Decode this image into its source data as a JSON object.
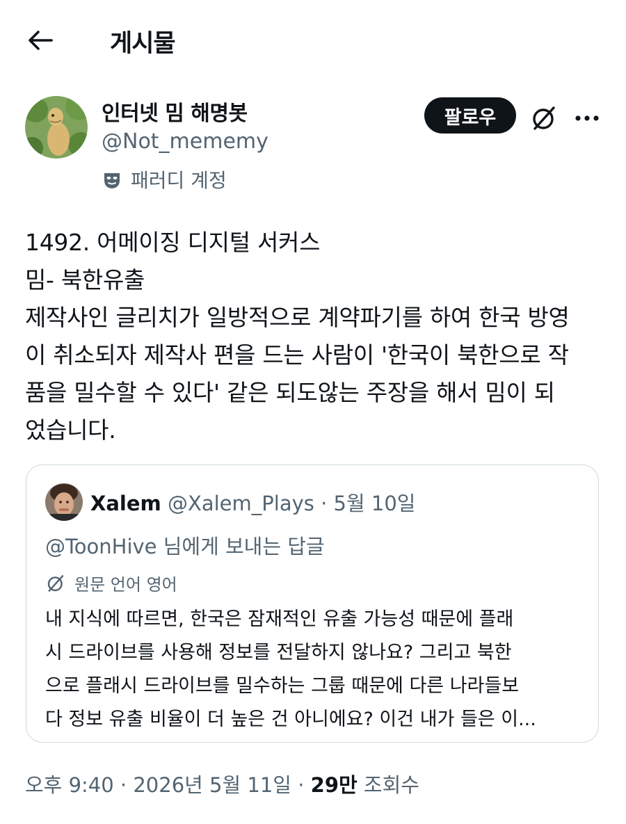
{
  "header": {
    "title": "게시물",
    "back_icon": "arrow-left-icon"
  },
  "author": {
    "display_name": "인터넷 밈 해명봇",
    "handle": "@Not_mememy",
    "parody_label": "패러디 계정",
    "follow_label": "팔로우"
  },
  "post": {
    "lines": [
      "1492. 어메이징 디지털 서커스",
      "밈- 북한유출",
      "제작사인 글리치가 일방적으로 계약파기를 하여 한국 방영",
      "이 취소되자 제작사 편을 드는 사람이 '한국이 북한으로 작",
      "품을 밀수할 수 있다' 같은 되도않는 주장을 해서 밈이 되",
      "었습니다."
    ]
  },
  "quote": {
    "name": "Xalem",
    "handle": "@Xalem_Plays",
    "separator": "·",
    "date": "5월 10일",
    "reply_to": "@ToonHive 님에게 보내는 답글",
    "original_language": "원문 언어 영어",
    "lines": [
      "내 지식에 따르면, 한국은 잠재적인 유출 가능성 때문에 플래",
      "시 드라이브를 사용해 정보를 전달하지 않나요? 그리고 북한",
      "으로 플래시 드라이브를 밀수하는 그룹 때문에 다른 나라들보",
      "다 정보 유출 비율이 더 높은 건 아니에요? 이건 내가 들은 이..."
    ]
  },
  "footer": {
    "time": "오후 9:40",
    "sep1": "·",
    "date": "2026년 5월 11일",
    "sep2": "·",
    "views_count": "29만",
    "views_label": "조회수"
  },
  "colors": {
    "text": "#0f1419",
    "muted": "#536471",
    "border": "#cfd9de",
    "button_bg": "#0f1419"
  }
}
